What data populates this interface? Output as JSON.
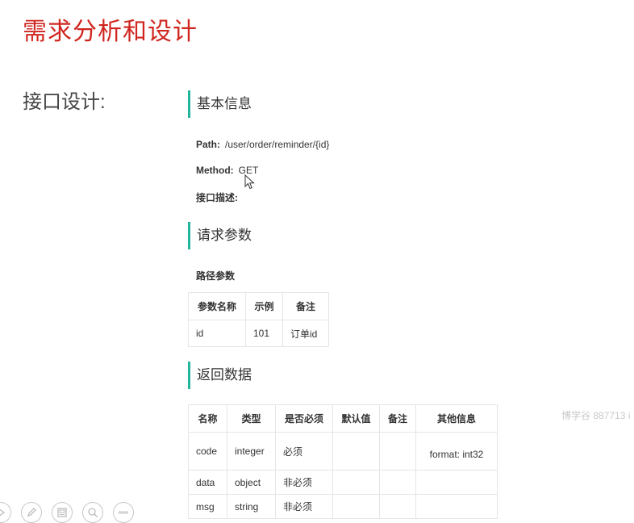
{
  "page": {
    "title": "需求分析和设计",
    "section_label": "接口设计:"
  },
  "basic_info": {
    "heading": "基本信息",
    "path_label": "Path:",
    "path_value": "/user/order/reminder/{id}",
    "method_label": "Method:",
    "method_value": "GET",
    "desc_label": "接口描述:"
  },
  "request": {
    "heading": "请求参数",
    "path_params_title": "路径参数",
    "columns": [
      "参数名称",
      "示例",
      "备注"
    ],
    "rows": [
      [
        "id",
        "101",
        "订单id"
      ]
    ]
  },
  "response": {
    "heading": "返回数据",
    "columns": [
      "名称",
      "类型",
      "是否必须",
      "默认值",
      "备注",
      "其他信息"
    ],
    "rows": [
      [
        "code",
        "integer",
        "必须",
        "",
        "",
        "format: int32"
      ],
      [
        "data",
        "object",
        "非必须",
        "",
        "",
        ""
      ],
      [
        "msg",
        "string",
        "非必须",
        "",
        "",
        ""
      ]
    ]
  },
  "watermark": "博学谷 887713 i",
  "toolbar": {
    "icons": [
      "play-icon",
      "pen-icon",
      "slides-icon",
      "zoom-icon",
      "more-icon"
    ]
  }
}
